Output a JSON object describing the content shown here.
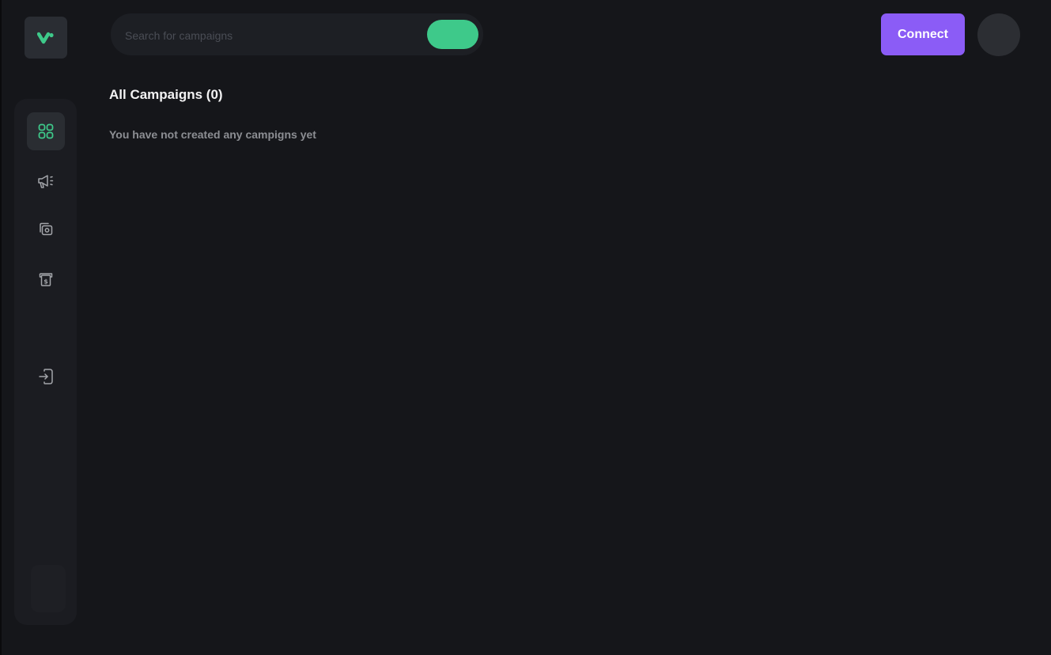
{
  "search": {
    "placeholder": "Search for campaigns"
  },
  "header": {
    "connect_label": "Connect"
  },
  "main": {
    "title": "All Campaigns (0)",
    "empty_message": "You have not created any campigns yet"
  },
  "sidebar": {
    "items": [
      {
        "icon": "dashboard-grid-icon",
        "active": true
      },
      {
        "icon": "megaphone-icon",
        "active": false
      },
      {
        "icon": "media-library-icon",
        "active": false
      },
      {
        "icon": "billing-receipt-icon",
        "active": false
      },
      {
        "icon": "login-icon",
        "active": false
      }
    ]
  },
  "colors": {
    "background": "#15161a",
    "accent_green": "#3ec98a",
    "connect_purple": "#8b5cf6",
    "sidebar": "#1b1c21"
  }
}
